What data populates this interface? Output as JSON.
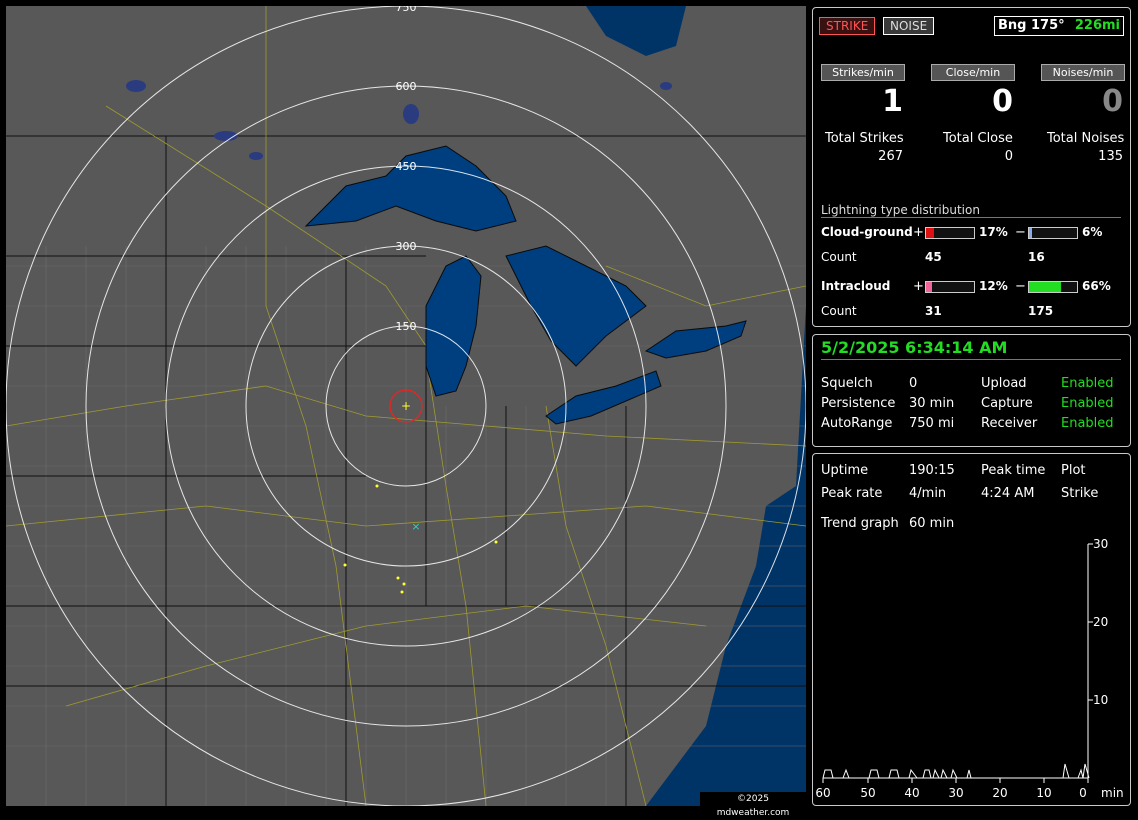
{
  "header": {
    "strike_btn": "STRIKE",
    "noise_btn": "NOISE",
    "bearing": "Bng 175°",
    "distance": "226mi"
  },
  "rates": {
    "strikes_label": "Strikes/min",
    "strikes_value": "1",
    "close_label": "Close/min",
    "close_value": "0",
    "noises_label": "Noises/min",
    "noises_value": "0"
  },
  "totals": {
    "strikes_label": "Total Strikes",
    "strikes_value": "267",
    "close_label": "Total Close",
    "close_value": "0",
    "noises_label": "Total Noises",
    "noises_value": "135"
  },
  "distribution": {
    "title": "Lightning type distribution",
    "cg_label": "Cloud-ground",
    "cg_pos_sign": "+",
    "cg_pos_pct": "17%",
    "cg_neg_sign": "−",
    "cg_neg_pct": "6%",
    "cg_count_label": "Count",
    "cg_pos_count": "45",
    "cg_neg_count": "16",
    "ic_label": "Intracloud",
    "ic_pos_sign": "+",
    "ic_pos_pct": "12%",
    "ic_neg_sign": "−",
    "ic_neg_pct": "66%",
    "ic_count_label": "Count",
    "ic_pos_count": "31",
    "ic_neg_count": "175",
    "cg_pos_fill": 0.17,
    "cg_neg_fill": 0.06,
    "ic_pos_fill": 0.12,
    "ic_neg_fill": 0.66,
    "colors": {
      "cg_pos": "#dd1111",
      "cg_neg": "#88aaee",
      "ic_pos": "#ee6699",
      "ic_neg": "#22dd22"
    }
  },
  "status": {
    "datetime": "5/2/2025 6:34:14 AM",
    "squelch_label": "Squelch",
    "squelch_value": "0",
    "persistence_label": "Persistence",
    "persistence_value": "30 min",
    "autorange_label": "AutoRange",
    "autorange_value": "750 mi",
    "upload_label": "Upload",
    "upload_value": "Enabled",
    "capture_label": "Capture",
    "capture_value": "Enabled",
    "receiver_label": "Receiver",
    "receiver_value": "Enabled"
  },
  "stats": {
    "uptime_label": "Uptime",
    "uptime_value": "190:15",
    "peak_time_label": "Peak time",
    "plot_label": "Plot",
    "peak_rate_label": "Peak rate",
    "peak_rate_value": "4/min",
    "peak_time_value": "4:24 AM",
    "plot_value": "Strike",
    "trend_label": "Trend graph",
    "trend_value": "60 min"
  },
  "trend": {
    "y_ticks": [
      "30",
      "20",
      "10"
    ],
    "x_ticks": [
      "60",
      "50",
      "40",
      "30",
      "20",
      "10",
      "0"
    ],
    "x_unit": "min"
  },
  "map": {
    "range_labels": [
      "150",
      "300",
      "450",
      "600",
      "750"
    ],
    "copyright": "©2025 mdweather.com"
  }
}
